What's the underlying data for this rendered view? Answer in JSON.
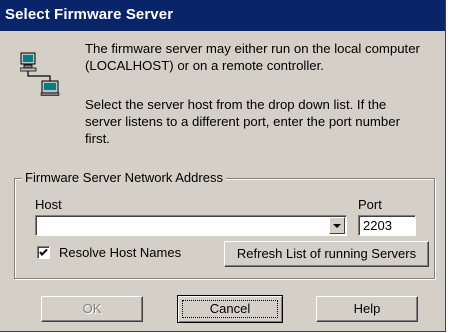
{
  "window": {
    "title": "Select Firmware Server"
  },
  "icon": "network-computers-icon",
  "info": {
    "line1": "The firmware server may either run on the local computer (LOCALHOST) or on a remote controller.",
    "line2": "Select the server host from the drop down list. If the server listens to a different port, enter the port number first."
  },
  "group": {
    "legend": "Firmware Server Network Address",
    "host_label": "Host",
    "host_value": "",
    "port_label": "Port",
    "port_value": "2203",
    "resolve_label": "Resolve Host Names",
    "resolve_checked": true,
    "refresh_label": "Refresh List of running Servers"
  },
  "buttons": {
    "ok": "OK",
    "cancel": "Cancel",
    "help": "Help"
  },
  "colors": {
    "titlebar": "#0a246a",
    "face": "#d4d0c8"
  }
}
